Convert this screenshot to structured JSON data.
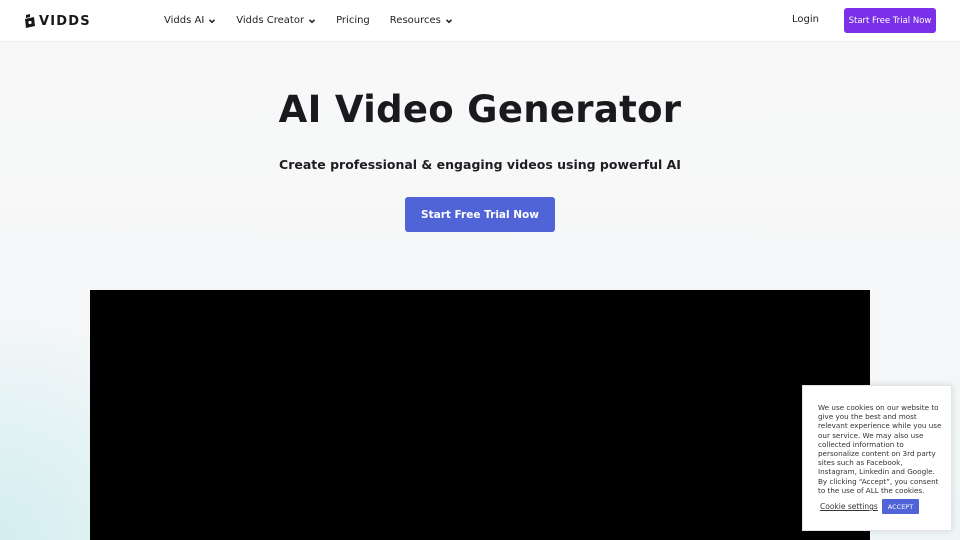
{
  "brand": {
    "name": "VIDDS"
  },
  "nav": {
    "items": [
      {
        "label": "Vidds AI",
        "has_dropdown": true
      },
      {
        "label": "Vidds Creator",
        "has_dropdown": true
      },
      {
        "label": "Pricing",
        "has_dropdown": false
      },
      {
        "label": "Resources",
        "has_dropdown": true
      }
    ],
    "login_label": "Login",
    "cta_label": "Start Free Trial Now"
  },
  "hero": {
    "title": "AI Video Generator",
    "subtitle": "Create professional & engaging videos using powerful AI",
    "cta_label": "Start Free Trial Now"
  },
  "cookie": {
    "text": "We use cookies on our website to give you the best and most relevant experience while you use our service. We may also use collected information to personalize content on 3rd party sites such as Facebook, Instagram, Linkedin and Google. By clicking “Accept”, you consent to the use of ALL the cookies.",
    "settings_label": "Cookie settings",
    "accept_label": "ACCEPT"
  },
  "colors": {
    "header_cta": "#7a2fe8",
    "hero_cta": "#5064d8",
    "accept": "#5064d8",
    "video_bg": "#000000"
  },
  "icons": {
    "logo": "vidds-logo-icon",
    "dropdown": "chevron-down-icon"
  }
}
